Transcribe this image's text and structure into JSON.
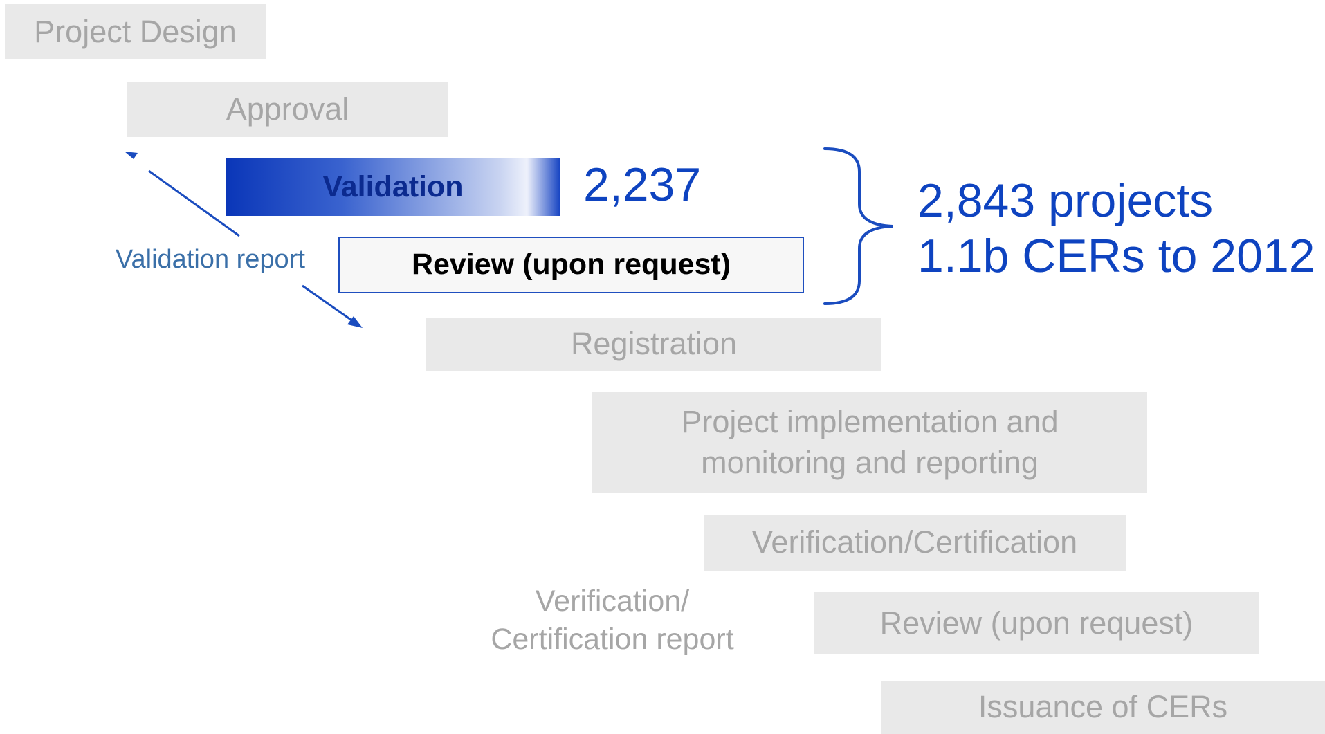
{
  "steps": {
    "project_design": "Project Design",
    "approval": "Approval",
    "validation": "Validation",
    "review": "Review (upon request)",
    "registration": "Registration",
    "implementation_line1": "Project implementation and",
    "implementation_line2": "monitoring and reporting",
    "verification": "Verification/Certification",
    "review_second": "Review (upon request)",
    "issuance": "Issuance of CERs"
  },
  "annotations": {
    "validation_count": "2,237",
    "summary_line1": "2,843 projects",
    "summary_line2": "1.1b CERs to 2012",
    "validation_report": "Validation report",
    "verification_report_line1": "Verification/",
    "verification_report_line2": "Certification report"
  },
  "colors": {
    "accent_blue": "#0e43c0",
    "inactive_grey": "#e9e9e9",
    "inactive_text": "#a6a6a6"
  }
}
